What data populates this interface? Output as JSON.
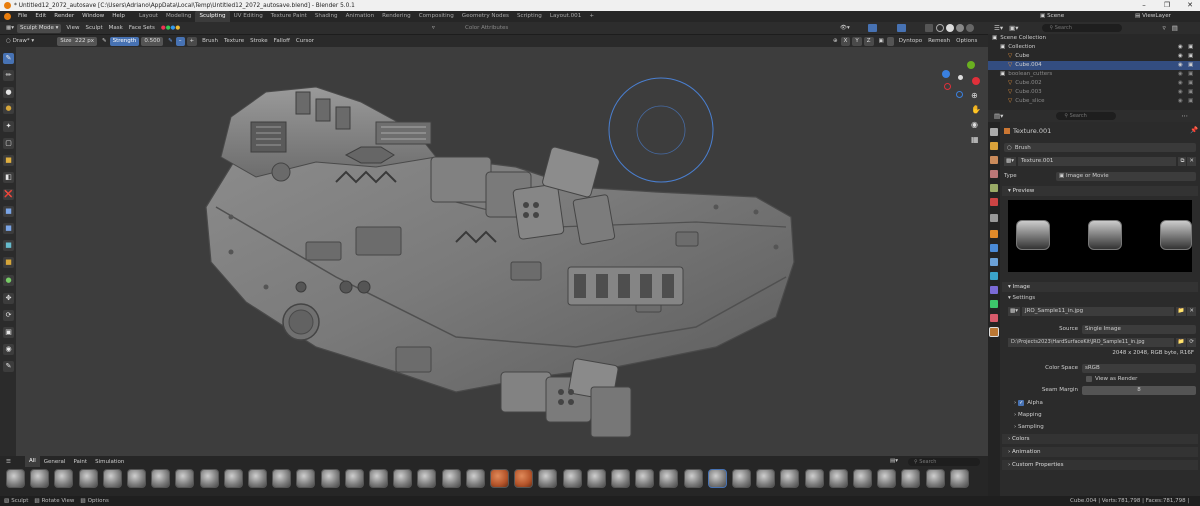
{
  "window": {
    "title": "* Untitled12_2072_autosave [C:\\Users\\Adriano\\AppData\\Local\\Temp\\Untitled12_2072_autosave.blend] - Blender 5.0.1"
  },
  "menu": [
    "File",
    "Edit",
    "Render",
    "Window",
    "Help"
  ],
  "workspaces": [
    "Layout",
    "Modeling",
    "Sculpting",
    "UV Editing",
    "Texture Paint",
    "Shading",
    "Animation",
    "Rendering",
    "Compositing",
    "Geometry Nodes",
    "Scripting",
    "Layout.001"
  ],
  "active_workspace": "Sculpting",
  "scene": {
    "label": "Scene",
    "view_layer": "ViewLayer"
  },
  "viewport_header": {
    "mode": "Sculpt Mode",
    "menus": [
      "View",
      "Sculpt",
      "Mask",
      "Face Sets"
    ],
    "color_attributes": "Color Attributes"
  },
  "tool_settings": {
    "brush": "Draw*",
    "size_label": "Size",
    "size_value": "222 px",
    "strength_label": "Strength",
    "strength_value": "0.500",
    "menus": [
      "Brush",
      "Texture",
      "Stroke",
      "Falloff",
      "Cursor"
    ],
    "axes": [
      "X",
      "Y",
      "Z"
    ],
    "dyntopo": "Dyntopo",
    "remesh": "Remesh",
    "options": "Options"
  },
  "outliner": {
    "search_placeholder": "Search",
    "rows": [
      {
        "label": "Scene Collection",
        "indent": 0,
        "state": "normal"
      },
      {
        "label": "Collection",
        "indent": 1,
        "state": "normal"
      },
      {
        "label": "Cube",
        "indent": 2,
        "state": "normal"
      },
      {
        "label": "Cube.004",
        "indent": 2,
        "state": "selected"
      },
      {
        "label": "boolean_cutters",
        "indent": 1,
        "state": "dim"
      },
      {
        "label": "Cube.002",
        "indent": 2,
        "state": "dim"
      },
      {
        "label": "Cube.003",
        "indent": 2,
        "state": "dim"
      },
      {
        "label": "Cube_slice",
        "indent": 2,
        "state": "dim"
      }
    ]
  },
  "properties": {
    "search_placeholder": "Search",
    "texture_name": "Texture.001",
    "brush_label": "Brush",
    "texture_field": "Texture.001",
    "type_label": "Type",
    "type_value": "Image or Movie",
    "preview_label": "Preview",
    "image_label": "Image",
    "settings_label": "Settings",
    "image_file": "JRO_Sample11_in.jpg",
    "source_label": "Source",
    "source_value": "Single Image",
    "filepath": "D:\\Projects2023\\HardSurfaceKit\\JRO_Sample11_in.jpg",
    "image_info": "2048 x 2048,  RGB byte, R16F",
    "color_space_label": "Color Space",
    "color_space_value": "sRGB",
    "view_as_render": "View as Render",
    "seam_margin_label": "Seam Margin",
    "seam_margin_value": "8",
    "alpha_label": "Alpha",
    "mapping_label": "Mapping",
    "sampling_label": "Sampling",
    "colors_label": "Colors",
    "animation_label": "Animation",
    "custom_props_label": "Custom Properties"
  },
  "asset_bar": {
    "tabs": [
      "All",
      "General",
      "Paint",
      "Simulation"
    ],
    "search_placeholder": "Search"
  },
  "status": {
    "left_items": [
      "Sculpt",
      "Rotate View",
      "Options"
    ],
    "right_text": "Cube.004 | Verts:781,798 | Faces:781,798 | 5.0.1"
  },
  "colors": {
    "accent": "#4772b3",
    "viewport_bg": "#3d3d3d",
    "selection": "#334d80",
    "brush_circle": "#4a7fd0",
    "axis_x": "#e0303a",
    "axis_y": "#6ab020",
    "axis_z": "#3a80e0"
  }
}
